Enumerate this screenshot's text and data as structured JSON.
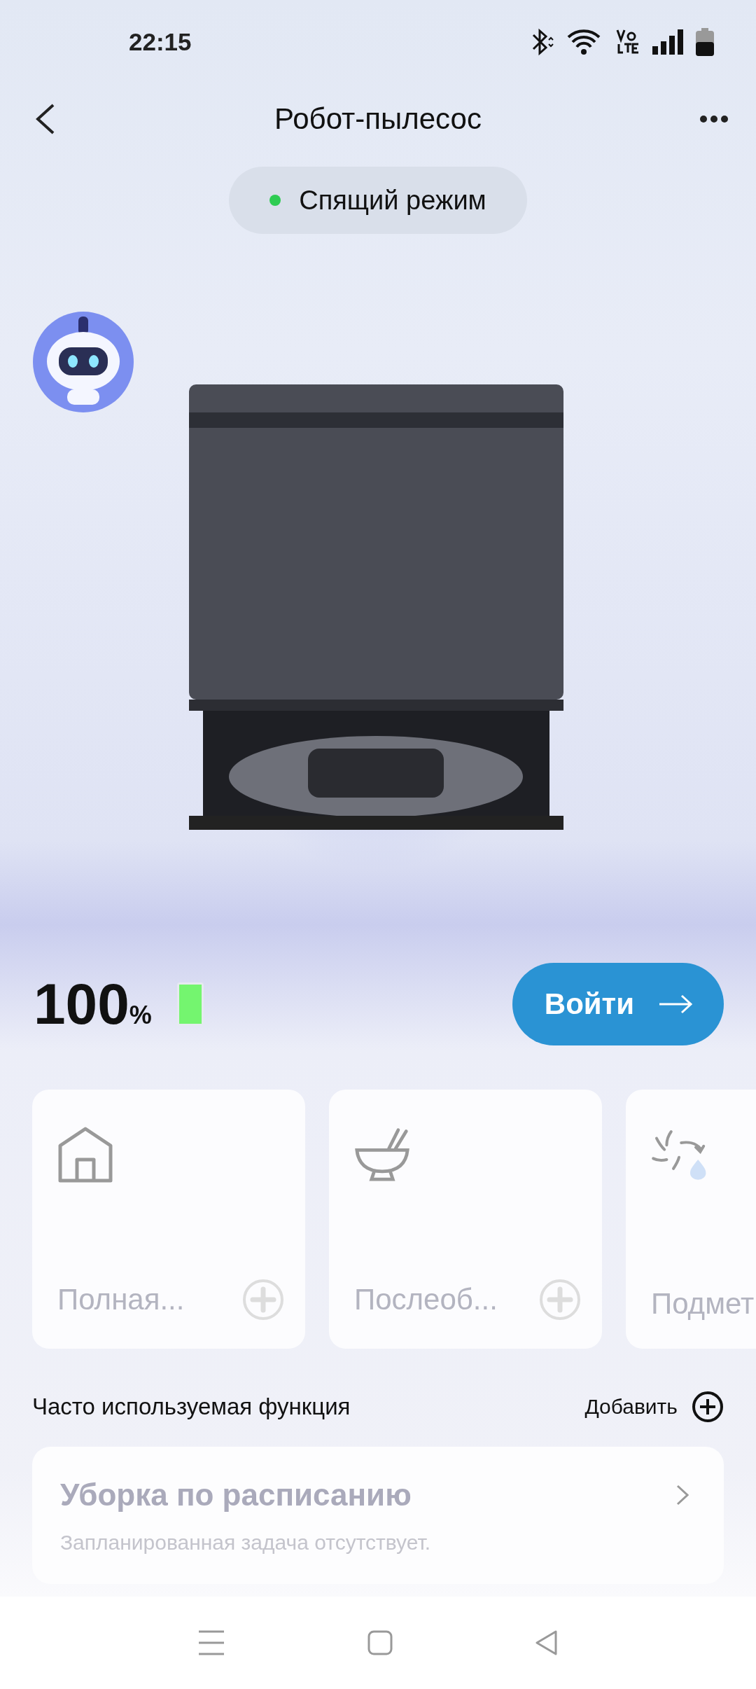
{
  "status_bar": {
    "time": "22:15"
  },
  "header": {
    "title": "Робот-пылесос"
  },
  "status": {
    "label": "Спящий режим",
    "color": "#2ecc52"
  },
  "battery": {
    "percent": "100",
    "unit": "%",
    "level": 1.0
  },
  "enter_button": {
    "label": "Войти"
  },
  "mode_cards": [
    {
      "label": "Полная...",
      "addable": true
    },
    {
      "label": "Послеоб...",
      "addable": true
    },
    {
      "label": "Подмет",
      "addable": false
    }
  ],
  "functions": {
    "title": "Часто используемая функция",
    "add_label": "Добавить"
  },
  "schedule": {
    "title": "Уборка по расписанию",
    "subtitle": "Запланированная задача отсутствует."
  }
}
